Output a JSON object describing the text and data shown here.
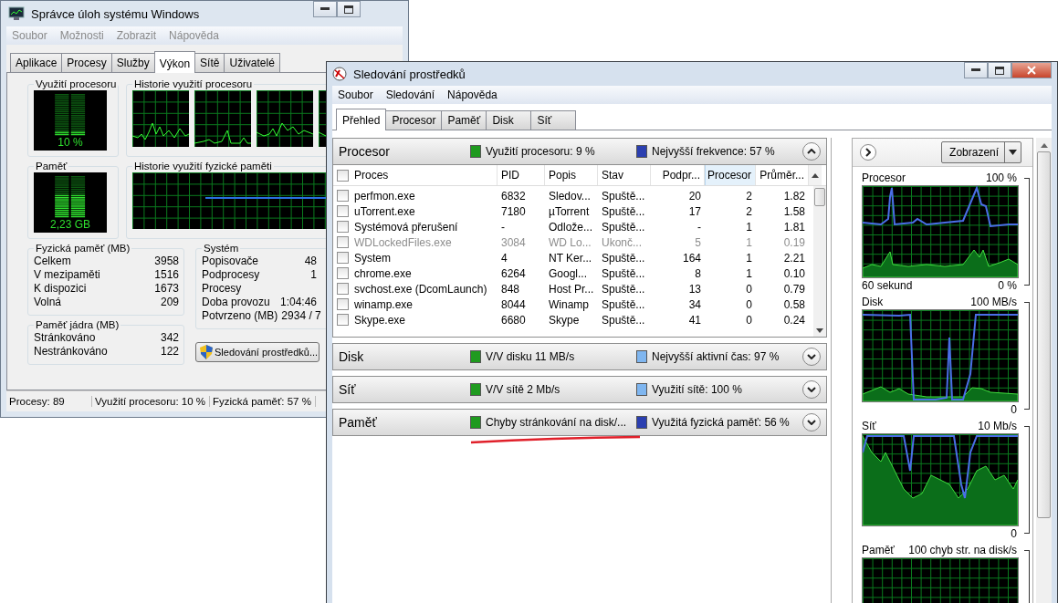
{
  "task_manager": {
    "title": "Správce úloh systému Windows",
    "menu": [
      "Soubor",
      "Možnosti",
      "Zobrazit",
      "Nápověda"
    ],
    "tabs": [
      {
        "label": "Aplikace",
        "selected": false
      },
      {
        "label": "Procesy",
        "selected": false
      },
      {
        "label": "Služby",
        "selected": false
      },
      {
        "label": "Výkon",
        "selected": true
      },
      {
        "label": "Sítě",
        "selected": false
      },
      {
        "label": "Uživatelé",
        "selected": false
      }
    ],
    "cpu_usage": {
      "title": "Využití procesoru",
      "reading": "10 %",
      "level": 0.1
    },
    "cpu_history": {
      "title": "Historie využití procesoru"
    },
    "memory": {
      "title": "Paměť",
      "reading": "2,23 GB",
      "level": 0.57
    },
    "memory_history": {
      "title": "Historie využití fyzické paměti"
    },
    "physical_memory": {
      "title": "Fyzická paměť (MB)",
      "rows": [
        {
          "label": "Celkem",
          "value": "3958"
        },
        {
          "label": "V mezipaměti",
          "value": "1516"
        },
        {
          "label": "K dispozici",
          "value": "1673"
        },
        {
          "label": "Volná",
          "value": "209"
        }
      ]
    },
    "kernel_memory": {
      "title": "Paměť jádra (MB)",
      "rows": [
        {
          "label": "Stránkováno",
          "value": "342"
        },
        {
          "label": "Nestránkováno",
          "value": "122"
        }
      ]
    },
    "system": {
      "title": "Systém",
      "rows": [
        {
          "label": "Popisovače",
          "value": "48"
        },
        {
          "label": "Podprocesy",
          "value": "1"
        },
        {
          "label": "Procesy"
        },
        {
          "label": "Doba provozu",
          "value": "1:04:46"
        },
        {
          "label": "Potvrzeno (MB)",
          "value": "2934 / 7"
        }
      ]
    },
    "resource_button": "Sledování prostředků...",
    "status_bar": [
      "Procesy: 89",
      "Využití procesoru: 10 %",
      "Fyzická paměť: 57 %"
    ]
  },
  "resource_monitor": {
    "title": "Sledování prostředků",
    "menu": [
      "Soubor",
      "Sledování",
      "Nápověda"
    ],
    "tabs": [
      {
        "label": "Přehled",
        "selected": true
      },
      {
        "label": "Procesor",
        "selected": false
      },
      {
        "label": "Paměť",
        "selected": false
      },
      {
        "label": "Disk",
        "selected": false
      },
      {
        "label": "Síť",
        "selected": false
      }
    ],
    "sections": [
      {
        "title": "Procesor",
        "expanded": true,
        "metrics": [
          {
            "label": "Využití procesoru: 9 %",
            "color": "#1f9a1f"
          },
          {
            "label": "Nejvyšší frekvence: 57 %",
            "color": "#2b3fb0"
          }
        ]
      },
      {
        "title": "Disk",
        "expanded": false,
        "metrics": [
          {
            "label": "V/V disku 11 MB/s",
            "color": "#1f9a1f"
          },
          {
            "label": "Nejvyšší aktivní čas: 97 %",
            "color": "#7fb6f0"
          }
        ]
      },
      {
        "title": "Síť",
        "expanded": false,
        "metrics": [
          {
            "label": "V/V sítě 2 Mb/s",
            "color": "#1f9a1f"
          },
          {
            "label": "Využití sítě: 100 %",
            "color": "#7fb6f0"
          }
        ]
      },
      {
        "title": "Paměť",
        "expanded": false,
        "annotated": true,
        "metrics": [
          {
            "label": "Chyby stránkování na disk/...",
            "color": "#1f9a1f"
          },
          {
            "label": "Využitá fyzická paměť: 56 %",
            "color": "#2b3fb0"
          }
        ]
      }
    ],
    "columns": [
      {
        "label": "Proces",
        "sorted": false
      },
      {
        "label": "PID",
        "sorted": false
      },
      {
        "label": "Popis",
        "sorted": false
      },
      {
        "label": "Stav",
        "sorted": false
      },
      {
        "label": "Podpr...",
        "sorted": false
      },
      {
        "label": "Procesor",
        "sorted": true
      },
      {
        "label": "Průměr...",
        "sorted": false
      }
    ],
    "rows": [
      {
        "checked": false,
        "disabled": false,
        "cells": [
          "perfmon.exe",
          "6832",
          "Sledov...",
          "Spuště...",
          "20",
          "2",
          "1.82"
        ]
      },
      {
        "checked": false,
        "disabled": false,
        "cells": [
          "uTorrent.exe",
          "7180",
          "µTorrent",
          "Spuště...",
          "17",
          "2",
          "1.58"
        ]
      },
      {
        "checked": false,
        "disabled": false,
        "cells": [
          "Systémová přerušení",
          "-",
          "Odlože...",
          "Spuště...",
          "-",
          "1",
          "1.81"
        ]
      },
      {
        "checked": false,
        "disabled": true,
        "cells": [
          "WDLockedFiles.exe",
          "3084",
          "WD Lo...",
          "Ukonč...",
          "5",
          "1",
          "0.19"
        ]
      },
      {
        "checked": false,
        "disabled": false,
        "cells": [
          "System",
          "4",
          "NT Ker...",
          "Spuště...",
          "164",
          "1",
          "2.21"
        ]
      },
      {
        "checked": false,
        "disabled": false,
        "cells": [
          "chrome.exe",
          "6264",
          "Googl...",
          "Spuště...",
          "8",
          "1",
          "0.10"
        ]
      },
      {
        "checked": false,
        "disabled": false,
        "cells": [
          "svchost.exe (DcomLaunch)",
          "848",
          "Host Pr...",
          "Spuště...",
          "13",
          "0",
          "0.79"
        ]
      },
      {
        "checked": false,
        "disabled": false,
        "cells": [
          "winamp.exe",
          "8044",
          "Winamp",
          "Spuště...",
          "34",
          "0",
          "0.58"
        ]
      },
      {
        "checked": false,
        "disabled": false,
        "cells": [
          "Skype.exe",
          "6680",
          "Skype",
          "Spuště...",
          "41",
          "0",
          "0.24"
        ]
      }
    ],
    "view_button": "Zobrazení",
    "graphs": [
      {
        "title": "Procesor",
        "max": "100 %",
        "time_span": "60 sekund",
        "min": "0 %"
      },
      {
        "title": "Disk",
        "max": "100 MB/s",
        "min": "0"
      },
      {
        "title": "Síť",
        "max": "10 Mb/s",
        "min": "0"
      },
      {
        "title": "Paměť",
        "max": "100 chyb str. na disk/s"
      }
    ]
  }
}
